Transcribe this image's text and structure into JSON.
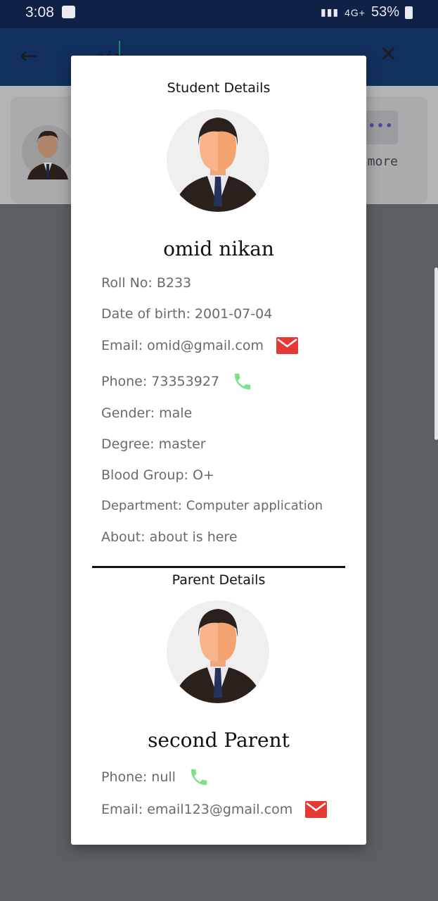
{
  "status_bar": {
    "time": "3:08",
    "network": "4G+",
    "battery": "53%"
  },
  "app_bar": {
    "query": "nim",
    "back_icon": "arrow-left-icon",
    "close_icon": "close-icon"
  },
  "background_card": {
    "more_label": "more"
  },
  "dialog": {
    "student_section_title": "Student Details",
    "student_name": "omid nikan",
    "student_fields": {
      "roll_no": "Roll No: B233",
      "dob": "Date of birth: 2001-07-04",
      "email": "Email: omid@gmail.com",
      "phone": "Phone: 73353927",
      "gender": "Gender: male",
      "degree": "Degree: master",
      "blood_group": "Blood Group: O+",
      "department": "Department: Computer application",
      "about": "About: about is here"
    },
    "parent_section_title": "Parent Details",
    "parent_name": "second Parent",
    "parent_fields": {
      "phone": "Phone: null",
      "email": "Email: email123@gmail.com"
    }
  },
  "colors": {
    "mail_icon": "#e53935",
    "phone_icon": "#7ee08a",
    "app_bar": "#12305e",
    "status_bar": "#0f2146"
  }
}
